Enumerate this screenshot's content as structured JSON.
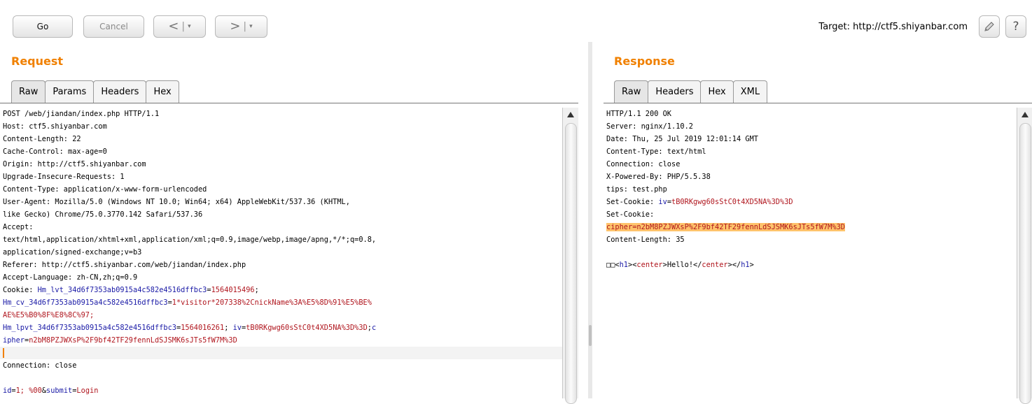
{
  "toolbar": {
    "go_label": "Go",
    "cancel_label": "Cancel",
    "back_arrow": "<",
    "forward_arrow": ">",
    "dropdown_glyph": "▾",
    "target_label": "Target: http://ctf5.shiyanbar.com",
    "help_label": "?"
  },
  "request": {
    "title": "Request",
    "tabs": [
      "Raw",
      "Params",
      "Headers",
      "Hex"
    ],
    "active_tab": "Raw",
    "lines": [
      [
        {
          "t": "POST /web/jiandan/index.php HTTP/1.1"
        }
      ],
      [
        {
          "t": "Host: ctf5.shiyanbar.com"
        }
      ],
      [
        {
          "t": "Content-Length: 22"
        }
      ],
      [
        {
          "t": "Cache-Control: max-age=0"
        }
      ],
      [
        {
          "t": "Origin: http://ctf5.shiyanbar.com"
        }
      ],
      [
        {
          "t": "Upgrade-Insecure-Requests: 1"
        }
      ],
      [
        {
          "t": "Content-Type: application/x-www-form-urlencoded"
        }
      ],
      [
        {
          "t": "User-Agent: Mozilla/5.0 (Windows NT 10.0; Win64; x64) AppleWebKit/537.36 (KHTML,"
        }
      ],
      [
        {
          "t": "like Gecko) Chrome/75.0.3770.142 Safari/537.36"
        }
      ],
      [
        {
          "t": "Accept:"
        }
      ],
      [
        {
          "t": "text/html,application/xhtml+xml,application/xml;q=0.9,image/webp,image/apng,*/*;q=0.8,"
        }
      ],
      [
        {
          "t": "application/signed-exchange;v=b3"
        }
      ],
      [
        {
          "t": "Referer: http://ctf5.shiyanbar.com/web/jiandan/index.php"
        }
      ],
      [
        {
          "t": "Accept-Language: zh-CN,zh;q=0.9"
        }
      ],
      [
        {
          "t": "Cookie: "
        },
        {
          "t": "Hm_lvt_34d6f7353ab0915a4c582e4516dffbc3",
          "c": "k"
        },
        {
          "t": "="
        },
        {
          "t": "1564015496",
          "c": "v"
        },
        {
          "t": ";"
        }
      ],
      [
        {
          "t": "Hm_cv_34d6f7353ab0915a4c582e4516dffbc3",
          "c": "k"
        },
        {
          "t": "="
        },
        {
          "t": "1*visitor*207338%2CnickName%3A%E5%8D%91%E5%BE%",
          "c": "v"
        }
      ],
      [
        {
          "t": "AE%E5%B0%8F%E8%8C%97;",
          "c": "v"
        }
      ],
      [
        {
          "t": "Hm_lpvt_34d6f7353ab0915a4c582e4516dffbc3",
          "c": "k"
        },
        {
          "t": "="
        },
        {
          "t": "1564016261",
          "c": "v"
        },
        {
          "t": "; "
        },
        {
          "t": "iv",
          "c": "k"
        },
        {
          "t": "="
        },
        {
          "t": "tB0RKgwg60sStC0t4XD5NA%3D%3D",
          "c": "v"
        },
        {
          "t": ";"
        },
        {
          "t": "c",
          "c": "k"
        }
      ],
      [
        {
          "t": "ipher",
          "c": "k"
        },
        {
          "t": "="
        },
        {
          "t": "n2bM8PZJWXsP%2F9bf42TF29fennLdSJSMK6sJTs5fW7M%3D",
          "c": "v"
        }
      ],
      [
        {
          "caret": true
        }
      ],
      [
        {
          "t": "Connection: close"
        }
      ],
      [
        {
          "t": ""
        }
      ],
      [
        {
          "t": "id",
          "c": "k"
        },
        {
          "t": "="
        },
        {
          "t": "1; %00",
          "c": "v"
        },
        {
          "t": "&"
        },
        {
          "t": "submit",
          "c": "k"
        },
        {
          "t": "="
        },
        {
          "t": "Login",
          "c": "v"
        }
      ]
    ]
  },
  "response": {
    "title": "Response",
    "tabs": [
      "Raw",
      "Headers",
      "Hex",
      "XML"
    ],
    "active_tab": "Raw",
    "lines": [
      [
        {
          "t": "HTTP/1.1 200 OK"
        }
      ],
      [
        {
          "t": "Server: nginx/1.10.2"
        }
      ],
      [
        {
          "t": "Date: Thu, 25 Jul 2019 12:01:14 GMT"
        }
      ],
      [
        {
          "t": "Content-Type: text/html"
        }
      ],
      [
        {
          "t": "Connection: close"
        }
      ],
      [
        {
          "t": "X-Powered-By: PHP/5.5.38"
        }
      ],
      [
        {
          "t": "tips: test.php"
        }
      ],
      [
        {
          "t": "Set-Cookie: "
        },
        {
          "t": "iv",
          "c": "k"
        },
        {
          "t": "="
        },
        {
          "t": "tB0RKgwg60sStC0t4XD5NA%3D%3D",
          "c": "v"
        }
      ],
      [
        {
          "t": "Set-Cookie:"
        }
      ],
      [
        {
          "t": "cipher",
          "c": "v hl"
        },
        {
          "t": "=n2bM8PZJWXsP%2F9bf42TF29fennLdSJSMK6sJTs5fW7M%3D",
          "c": "v hl"
        }
      ],
      [
        {
          "t": "Content-Length: 35"
        }
      ],
      [
        {
          "t": ""
        }
      ],
      [
        {
          "t": "□□<"
        },
        {
          "t": "h1",
          "c": "k"
        },
        {
          "t": "><"
        },
        {
          "t": "center",
          "c": "v"
        },
        {
          "t": ">Hello!</"
        },
        {
          "t": "center",
          "c": "v"
        },
        {
          "t": "></"
        },
        {
          "t": "h1",
          "c": "k"
        },
        {
          "t": ">"
        }
      ]
    ]
  },
  "colors": {
    "title": "#f08000",
    "key": "#1a1aa6",
    "value": "#b0161e",
    "highlight": "#ffc36b"
  },
  "icons": [
    "pencil-icon",
    "help-icon",
    "scroll-up-icon"
  ]
}
